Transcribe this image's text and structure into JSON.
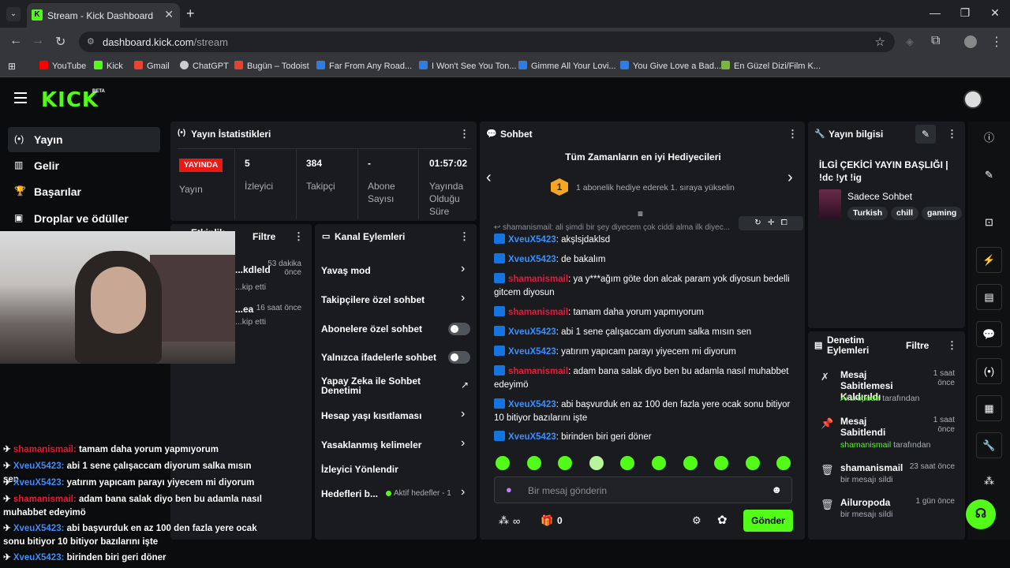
{
  "browser": {
    "tab_title": "Stream - Kick Dashboard",
    "tab_favicon": "K",
    "url_host": "dashboard.kick.com",
    "url_path": "/stream",
    "bookmarks": [
      {
        "label": "YouTube",
        "color": "#ff0000"
      },
      {
        "label": "Kick",
        "color": "#53fc18"
      },
      {
        "label": "Gmail",
        "color": "#ea4335"
      },
      {
        "label": "ChatGPT",
        "color": "#cccccc"
      },
      {
        "label": "Bugün – Todoist",
        "color": "#e44332"
      },
      {
        "label": "Far From Any Road...",
        "color": "#2f7de1"
      },
      {
        "label": "I Won't See You Ton...",
        "color": "#2f7de1"
      },
      {
        "label": "Gimme All Your Lovi...",
        "color": "#2f7de1"
      },
      {
        "label": "You Give Love a Bad...",
        "color": "#2f7de1"
      },
      {
        "label": "En Güzel Dizi/Film K...",
        "color": "#7cb342"
      }
    ]
  },
  "kick": {
    "logo": "KICK",
    "beta": "BETA",
    "accent": "#53fc18"
  },
  "sidebar": {
    "items": [
      {
        "label": "Yayın",
        "icon": "broadcast-icon"
      },
      {
        "label": "Gelir",
        "icon": "chart-icon"
      },
      {
        "label": "Başarılar",
        "icon": "trophy-icon"
      },
      {
        "label": "Droplar ve ödüller",
        "icon": "gift-icon"
      }
    ]
  },
  "stats": {
    "title": "Yayın İstatistikleri",
    "live_badge": "YAYINDA",
    "live_label": "Yayın",
    "viewers_value": "5",
    "viewers_label": "İzleyici",
    "followers_value": "384",
    "followers_label": "Takipçi",
    "subs_value": "-",
    "subs_label": "Abone Sayısı",
    "duration_value": "01:57:02",
    "duration_label": "Yayında Olduğu Süre"
  },
  "activity": {
    "title": "Etkinlik",
    "filter": "Filtre",
    "items": [
      {
        "name": "...kdleld",
        "time": "53 dakika önce",
        "action": "...kip etti"
      },
      {
        "name": "...ea",
        "time": "16 saat önce",
        "action": "...kip etti"
      }
    ]
  },
  "channel_actions": {
    "title": "Kanal Eylemleri",
    "items": {
      "slow": "Yavaş mod",
      "followers": "Takipçilere özel sohbet",
      "subs": "Abonelere özel sohbet",
      "emotes": "Yalnızca ifadelerle sohbet",
      "ai": "Yapay Zeka ile Sohbet Denetimi",
      "age": "Hesap yaşı kısıtlaması",
      "banned": "Yasaklanmış kelimeler",
      "redirect": "İzleyici Yönlendir",
      "goals": "Hedefleri b...",
      "goals_status": "Aktif hedefler - 1"
    }
  },
  "chat": {
    "title": "Sohbet",
    "gifters_title": "Tüm Zamanların en iyi Hediyecileri",
    "gifters_rank": "1",
    "gifters_text": "1 abonelik hediye ederek 1. sıraya yükselin",
    "pinned": "shamanismail: ali şimdi bir şey diyecem çok ciddi alma ilk diyec...",
    "messages": [
      {
        "user": "XveuX5423",
        "type": "u1",
        "text": "akşlsjdaklsd"
      },
      {
        "user": "XveuX5423",
        "type": "u1",
        "text": "de bakalım"
      },
      {
        "user": "shamanismail",
        "type": "u2",
        "text": "ya y***ağım göte don alcak param yok diyosun bedelli gitcem diyosun"
      },
      {
        "user": "shamanismail",
        "type": "u2",
        "text": "tamam daha yorum yapmıyorum"
      },
      {
        "user": "XveuX5423",
        "type": "u1",
        "text": "abi 1 sene çalışaccam diyorum salka mısın sen"
      },
      {
        "user": "XveuX5423",
        "type": "u1",
        "text": "yatırım yapıcam parayı yiyecem mi diyorum"
      },
      {
        "user": "shamanismail",
        "type": "u2",
        "text": "adam bana salak diyo ben bu adamla nasıl muhabbet edeyimö"
      },
      {
        "user": "XveuX5423",
        "type": "u1",
        "text": "abi başvurduk en az 100 den fazla yere ocak sonu bitiyor 10 bitiyor bazılarını işte"
      },
      {
        "user": "XveuX5423",
        "type": "u1",
        "text": "birinden biri geri döner"
      }
    ],
    "input_placeholder": "Bir mesaj gönderin",
    "points": "∞",
    "gift_count": "0",
    "send": "Gönder"
  },
  "overlay_chat": [
    {
      "user": "shamanismail:",
      "type": "u2",
      "text": "tamam daha yorum yapmıyorum"
    },
    {
      "user": "XveuX5423:",
      "type": "u1",
      "text": "abi 1 sene çalışaccam diyorum salka mısın sen"
    },
    {
      "user": "XveuX5423:",
      "type": "u1",
      "text": "yatırım yapıcam parayı yiyecem mi diyorum"
    },
    {
      "user": "shamanismail:",
      "type": "u2",
      "text": "adam bana salak diyo ben bu adamla nasıl muhabbet edeyimö"
    },
    {
      "user": "XveuX5423:",
      "type": "u1",
      "text": "abi başvurduk en az 100 den fazla yere ocak sonu bitiyor 10 bitiyor bazılarını işte"
    },
    {
      "user": "XveuX5423:",
      "type": "u1",
      "text": "birinden biri geri döner"
    }
  ],
  "stream_info": {
    "title": "Yayın bilgisi",
    "stream_title": "İLGİ ÇEKİCİ YAYIN BAŞLIĞI | !dc !yt !ig",
    "category": "Sadece Sohbet",
    "tags": [
      "Turkish",
      "chill",
      "gaming"
    ]
  },
  "moderation": {
    "title": "Denetim Eylemleri",
    "filter": "Filtre",
    "items": [
      {
        "title": "Mesaj Sabitlemesi Kaldırıldı",
        "time": "1 saat önce",
        "actor": "Ailuropoda",
        "suffix": "tarafından",
        "icon": "unpin-icon"
      },
      {
        "title": "Mesaj Sabitlendi",
        "time": "1 saat önce",
        "actor": "shamanismail",
        "suffix": "tarafından",
        "icon": "pin-icon"
      },
      {
        "title": "shamanismail",
        "time": "23 saat önce",
        "actor": "",
        "suffix": "bir mesajı sildi",
        "icon": "trash-icon"
      },
      {
        "title": "Ailuropoda",
        "time": "1 gün önce",
        "actor": "",
        "suffix": "bir mesajı sildi",
        "icon": "trash-icon"
      }
    ]
  }
}
